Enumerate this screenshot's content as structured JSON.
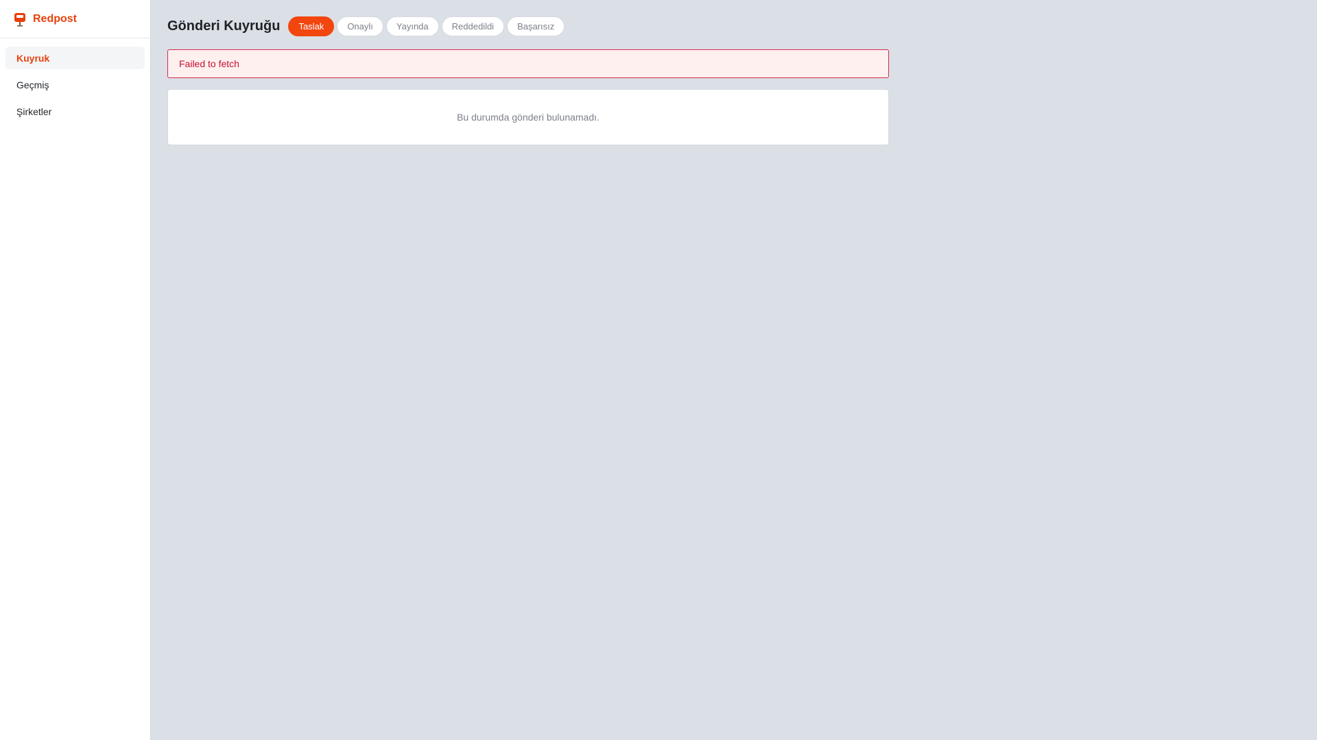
{
  "brand": {
    "name": "Redpost",
    "icon": "postbox-icon",
    "color": "#e8400c"
  },
  "sidebar": {
    "items": [
      {
        "label": "Kuyruk",
        "active": true
      },
      {
        "label": "Geçmiş",
        "active": false
      },
      {
        "label": "Şirketler",
        "active": false
      }
    ]
  },
  "header": {
    "title": "Gönderi Kuyruğu",
    "tabs": [
      {
        "label": "Taslak",
        "active": true
      },
      {
        "label": "Onaylı",
        "active": false
      },
      {
        "label": "Yayında",
        "active": false
      },
      {
        "label": "Reddedildi",
        "active": false
      },
      {
        "label": "Başarısız",
        "active": false
      }
    ]
  },
  "error": {
    "message": "Failed to fetch"
  },
  "empty_state": {
    "message": "Bu durumda gönderi bulunamadı."
  },
  "colors": {
    "accent": "#f2460e",
    "error_text": "#c8102e",
    "error_bg": "#fff0f0",
    "background": "#dbdfe6"
  }
}
